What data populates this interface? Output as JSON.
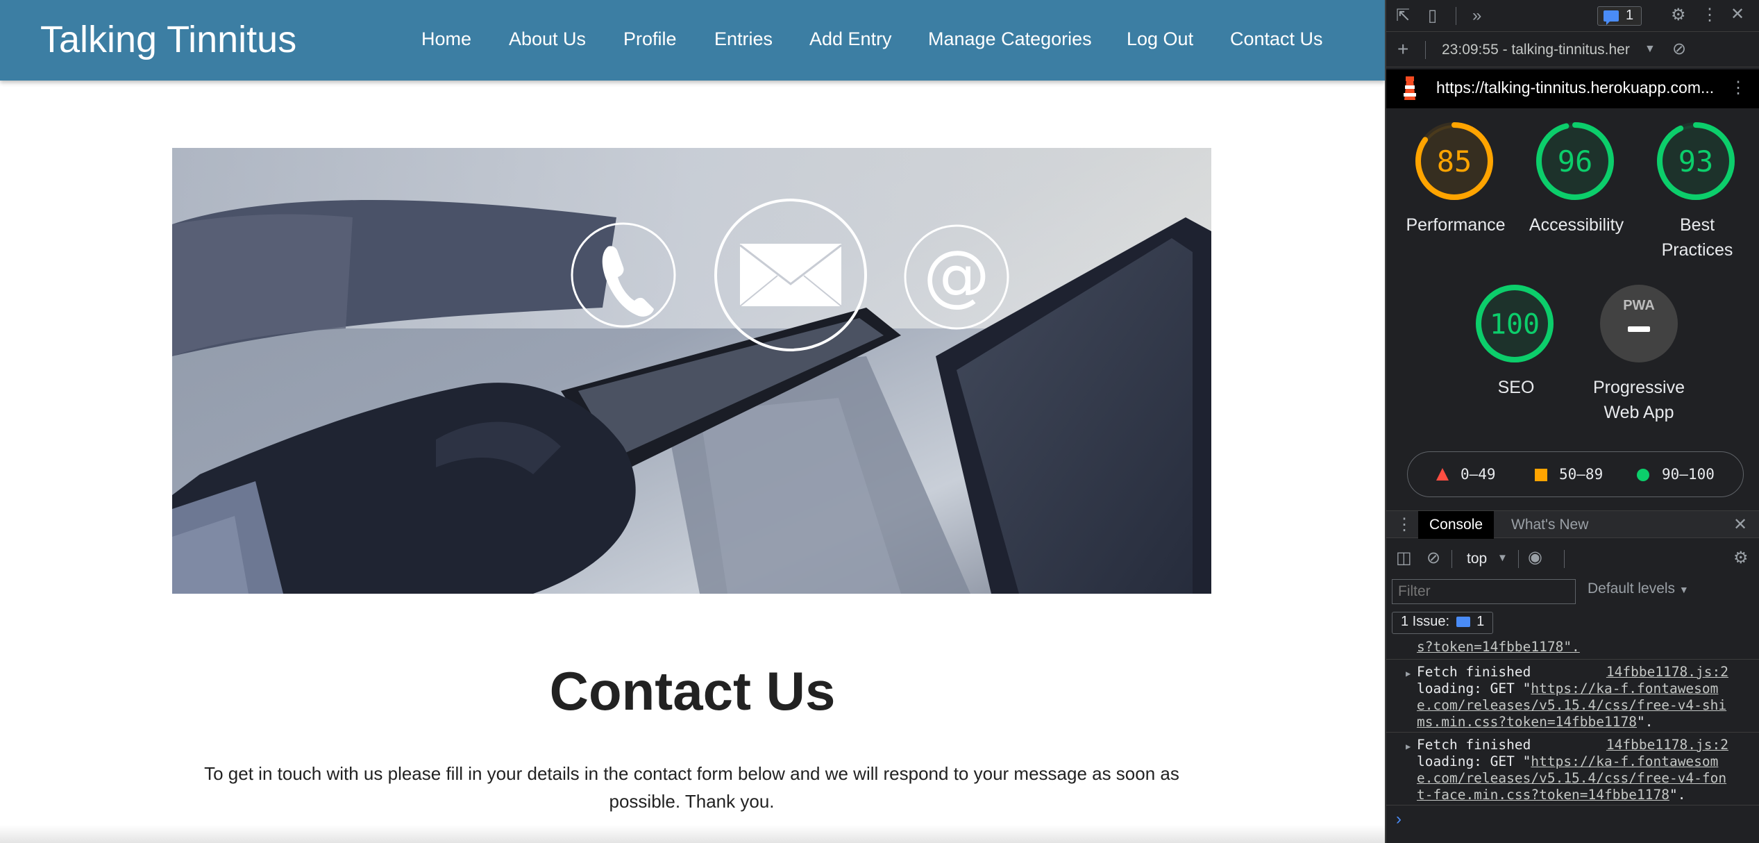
{
  "site": {
    "brand": "Talking Tinnitus",
    "nav": [
      "Home",
      "About Us",
      "Profile",
      "Entries",
      "Add Entry",
      "Manage Categories",
      "Log Out",
      "Contact Us"
    ],
    "contact_title": "Contact Us",
    "contact_text": "To get in touch with us please fill in your details in the contact form below and we will respond to your message as soon as possible. Thank you."
  },
  "devtools": {
    "issues_count": "1",
    "report_time": "23:09:55 - talking-tinnitus.her",
    "report_url": "https://talking-tinnitus.herokuapp.com...",
    "scores": [
      {
        "label_lines": [
          "Performance"
        ],
        "score": 85,
        "color": "#ffa400"
      },
      {
        "label_lines": [
          "Accessibility"
        ],
        "score": 96,
        "color": "#0cce6b"
      },
      {
        "label_lines": [
          "Best",
          "Practices"
        ],
        "score": 93,
        "color": "#0cce6b"
      },
      {
        "label_lines": [
          "SEO"
        ],
        "score": 100,
        "color": "#0cce6b"
      }
    ],
    "pwa": {
      "badge": "PWA",
      "label_lines": [
        "Progressive",
        "Web App"
      ]
    },
    "legend": [
      {
        "range": "0–49",
        "color": "#ff4e42",
        "shape": "triangle"
      },
      {
        "range": "50–89",
        "color": "#ffa400",
        "shape": "square"
      },
      {
        "range": "90–100",
        "color": "#0cce6b",
        "shape": "circle"
      }
    ],
    "tabs": [
      "Console",
      "What's New"
    ],
    "context": "top",
    "filter_placeholder": "Filter",
    "levels": "Default levels",
    "issue_line": "1 Issue:",
    "issue_line_count": "1",
    "log_fragment": "s?token=14fbbe1178\".",
    "logs": [
      {
        "title": "Fetch finished",
        "source": "14fbbe1178.js:2",
        "prefix": "loading: GET \"",
        "url_lines": [
          "https://ka-f.fontawesom",
          "e.com/releases/v5.15.4/css/free-v4-shi",
          "ms.min.css?token=14fbbe1178"
        ],
        "suffix": "\"."
      },
      {
        "title": "Fetch finished",
        "source": "14fbbe1178.js:2",
        "prefix": "loading: GET \"",
        "url_lines": [
          "https://ka-f.fontawesom",
          "e.com/releases/v5.15.4/css/free-v4-fon",
          "t-face.min.css?token=14fbbe1178"
        ],
        "suffix": "\"."
      }
    ]
  }
}
